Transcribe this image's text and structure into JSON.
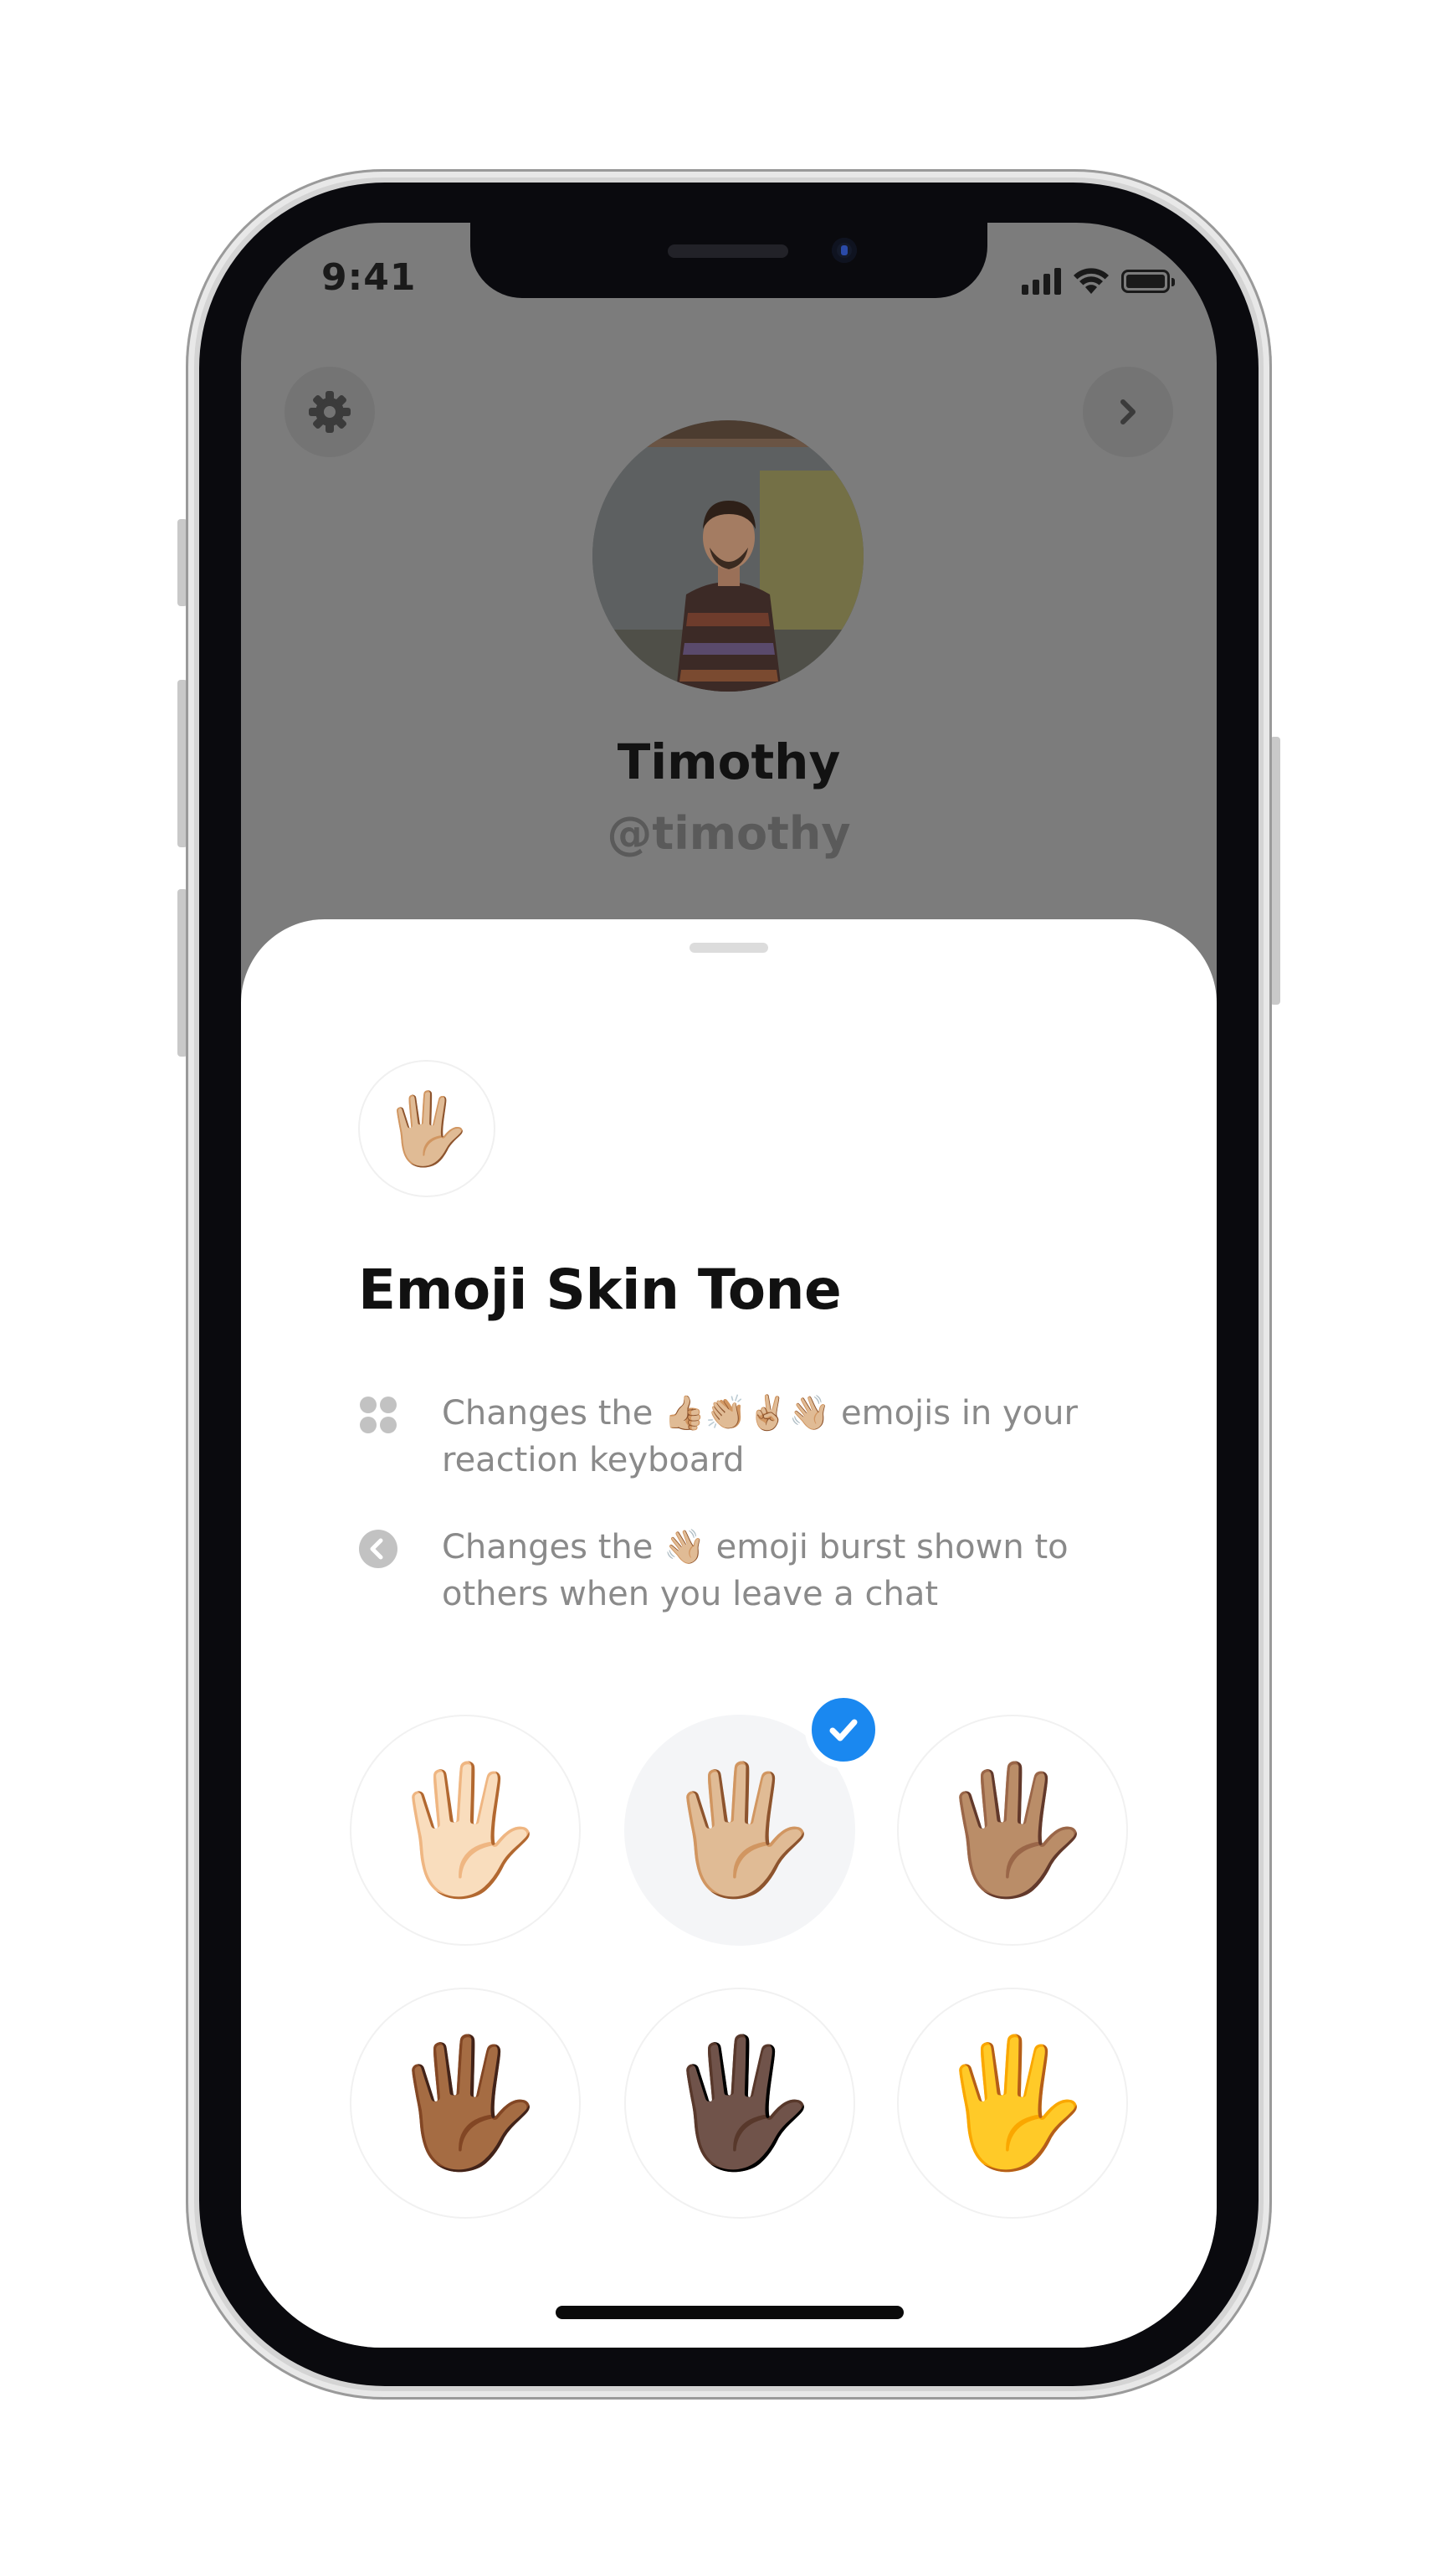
{
  "status_bar": {
    "time": "9:41"
  },
  "profile": {
    "name": "Timothy",
    "handle": "@timothy"
  },
  "top_controls": {
    "settings_icon": "gear-icon",
    "next_icon": "chevron-right-icon"
  },
  "sheet": {
    "header_emoji": "🖐🏼",
    "title": "Emoji Skin Tone",
    "info": [
      {
        "icon": "grid-dots-icon",
        "text": "Changes the 👍🏼👏🏼✌🏼👋🏼 emojis in your reaction keyboard"
      },
      {
        "icon": "back-arrow-circle-icon",
        "text": "Changes the 👋🏼 emoji burst shown to others when you leave a chat"
      }
    ],
    "tones": [
      {
        "emoji": "🖐🏻",
        "selected": false
      },
      {
        "emoji": "🖐🏼",
        "selected": true
      },
      {
        "emoji": "🖐🏽",
        "selected": false
      },
      {
        "emoji": "🖐🏾",
        "selected": false
      },
      {
        "emoji": "🖐🏿",
        "selected": false
      },
      {
        "emoji": "🖐",
        "selected": false
      }
    ],
    "selected_check_icon": "checkmark-icon"
  },
  "colors": {
    "accent": "#1a88f0",
    "dim_overlay": "#7c7c7c",
    "secondary_text": "#8a8a8a"
  }
}
